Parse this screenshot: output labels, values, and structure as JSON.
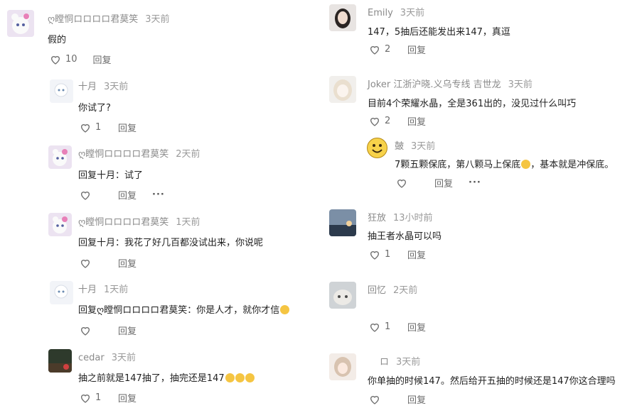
{
  "left": {
    "main": {
      "name": "ღ瞠恫ロロロロ君莫笑",
      "time": "3天前",
      "text": "假的",
      "likes": "10",
      "reply": "回复"
    },
    "replies": [
      {
        "name": "十月",
        "time": "3天前",
        "text": "你试了?",
        "likes": "1",
        "reply": "回复"
      },
      {
        "name": "ღ瞠恫ロロロロ君莫笑",
        "time": "2天前",
        "text": "回复十月：试了",
        "likes": "",
        "reply": "回复",
        "more": "···"
      },
      {
        "name": "ღ瞠恫ロロロロ君莫笑",
        "time": "1天前",
        "text": "回复十月：我花了好几百都没试出来，你说呢",
        "likes": "",
        "reply": "回复"
      },
      {
        "name": "十月",
        "time": "1天前",
        "text": "回复ღ瞠恫ロロロロ君莫笑：你是人才，就你才信",
        "likes": "",
        "reply": "回复"
      },
      {
        "name": "cedar",
        "time": "3天前",
        "text": "抽之前就是147抽了，抽完还是147",
        "likes": "1",
        "reply": "回复"
      }
    ]
  },
  "right": {
    "comments": [
      {
        "name": "Emily",
        "time": "3天前",
        "text": "147，5抽后还能发出来147，真逗",
        "likes": "2",
        "reply": "回复"
      },
      {
        "name": "Joker 江浙沪晓.义乌专线 吉世龙",
        "time": "3天前",
        "text": "目前4个荣耀水晶，全是361出的，没见过什么叫巧",
        "likes": "2",
        "reply": "回复"
      },
      {
        "name": "皷",
        "time": "3天前",
        "text": "7颗五颗保底，第八颗马上保底",
        "text2": "，基本就是冲保底。",
        "likes": "",
        "reply": "回复",
        "more": "···"
      },
      {
        "name": "狂放",
        "time": "13小时前",
        "text": "抽王者水晶可以吗",
        "likes": "1",
        "reply": "回复"
      },
      {
        "name": "回忆",
        "time": "2天前",
        "text": "",
        "likes": "1",
        "reply": "回复"
      },
      {
        "name": "ロ",
        "time": "3天前",
        "text": "你单抽的时候147。然后给开五抽的时候还是147你这合理吗",
        "likes": "",
        "reply": "回复"
      }
    ]
  },
  "colors": {
    "heart_stroke": "#6b6b6b",
    "emoji": "#f5c542"
  }
}
